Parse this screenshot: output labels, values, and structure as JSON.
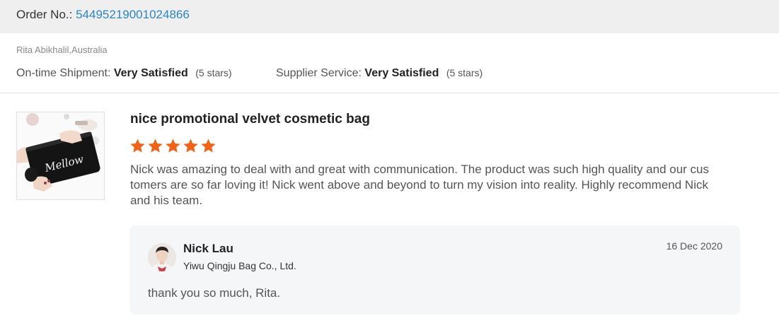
{
  "order": {
    "label": "Order No.:",
    "number": "54495219001024866"
  },
  "buyer": {
    "name_location": "Rita Abikhalil,Australia"
  },
  "ratings": [
    {
      "label": "On-time Shipment:",
      "value": "Very Satisfied",
      "stars_text": "(5 stars)"
    },
    {
      "label": "Supplier Service:",
      "value": "Very Satisfied",
      "stars_text": "(5 stars)"
    }
  ],
  "review": {
    "product_title": "nice promotional velvet cosmetic bag",
    "rating": 5,
    "rating_max": 5,
    "star_color": "#f06418",
    "text": "Nick was amazing to deal with and great with communication. The product was such high quality and our customers are so far loving it! Nick went above and beyond to turn my vision into reality. Highly recommend Nick and his team.",
    "thumbnail_icon": "product-photo-velvet-cosmetic-bag",
    "thumbnail_text": "Mellow"
  },
  "reply": {
    "name": "Nick Lau",
    "company": "Yiwu Qingju Bag Co., Ltd.",
    "date": "16 Dec 2020",
    "text": "thank you so much, Rita.",
    "avatar_icon": "user-avatar"
  },
  "colors": {
    "order_link": "#2e86c1",
    "header_bg": "#efefef",
    "reply_bg": "#f5f6f7"
  }
}
